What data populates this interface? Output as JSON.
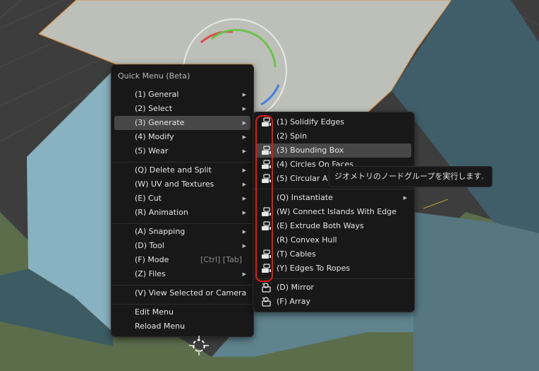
{
  "quick_menu": {
    "title": "Quick Menu (Beta)",
    "groups": [
      [
        {
          "label": "(1) General",
          "submenu": true
        },
        {
          "label": "(2) Select",
          "submenu": true
        },
        {
          "label": "(3) Generate",
          "submenu": true,
          "highlighted": true
        },
        {
          "label": "(4) Modify",
          "submenu": true
        },
        {
          "label": "(5) Wear",
          "submenu": true
        }
      ],
      [
        {
          "label": "(Q) Delete and Split",
          "submenu": true
        },
        {
          "label": "(W) UV and Textures",
          "submenu": true
        },
        {
          "label": "(E) Cut",
          "submenu": true
        },
        {
          "label": "(R) Animation",
          "submenu": true
        }
      ],
      [
        {
          "label": "(A) Snapping",
          "submenu": true
        },
        {
          "label": "(D) Tool",
          "submenu": true
        },
        {
          "label": "(F) Mode",
          "shortcut": "[Ctrl] [Tab]"
        },
        {
          "label": "(Z) Files",
          "submenu": true
        }
      ],
      [
        {
          "label": "(V) View Selected or Camera"
        }
      ],
      [
        {
          "label": "Edit Menu"
        },
        {
          "label": "Reload Menu"
        }
      ]
    ]
  },
  "generate_submenu": {
    "groups": [
      [
        {
          "label": "(1) Solidify Edges",
          "icon": "geometry-nodes-icon"
        },
        {
          "label": "(2) Spin",
          "icon": ""
        },
        {
          "label": "(3) Bounding Box",
          "icon": "geometry-nodes-icon",
          "highlighted": true
        },
        {
          "label": "(4) Circles On Faces",
          "icon": "geometry-nodes-icon"
        },
        {
          "label": "(5) Circular A",
          "icon": "geometry-nodes-icon"
        }
      ],
      [
        {
          "label": "(Q) Instantiate",
          "icon": "",
          "submenu": true
        },
        {
          "label": "(W) Connect Islands With Edge",
          "icon": "geometry-nodes-icon"
        },
        {
          "label": "(E) Extrude Both Ways",
          "icon": "geometry-nodes-icon"
        },
        {
          "label": "(R) Convex Hull",
          "icon": ""
        },
        {
          "label": "(T) Cables",
          "icon": "geometry-nodes-icon"
        },
        {
          "label": "(Y) Edges To Ropes",
          "icon": "geometry-nodes-icon"
        }
      ],
      [
        {
          "label": "(D) Mirror",
          "icon": "modifier-wrench-icon"
        },
        {
          "label": "(F) Array",
          "icon": "modifier-wrench-icon"
        }
      ]
    ]
  },
  "tooltip": {
    "text": "ジオメトリのノードグループを実行します."
  },
  "colors": {
    "menu_bg": "#181818",
    "highlight": "#474747",
    "annotation_outline": "#e01a1a",
    "gizmo_x": "#e0474a",
    "gizmo_y": "#6cc24a",
    "gizmo_z": "#3f7fe0"
  }
}
